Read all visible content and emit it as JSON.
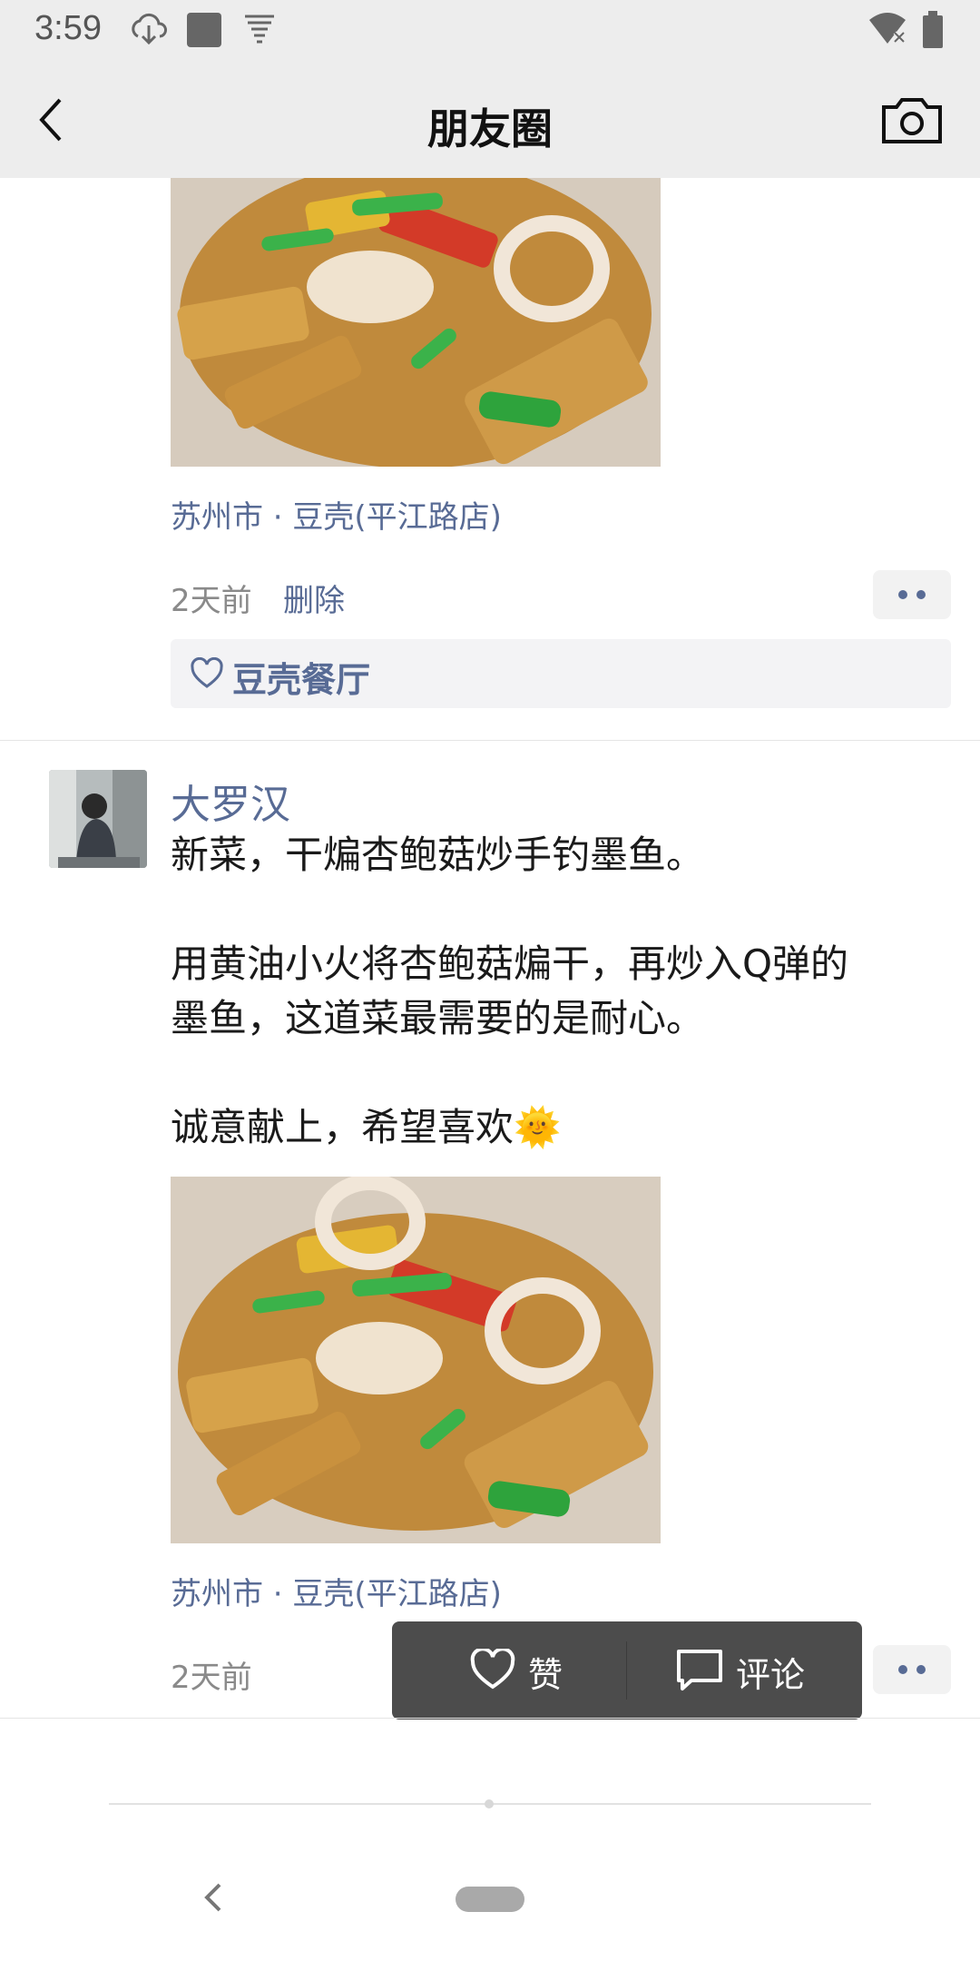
{
  "status_bar": {
    "time": "3:59"
  },
  "header": {
    "title": "朋友圈"
  },
  "post_top": {
    "location": "苏州市 · 豆壳(平江路店)",
    "time_ago": "2天前",
    "delete_label": "删除",
    "likes": [
      "豆壳餐厅"
    ]
  },
  "post_main": {
    "author": "大罗汉",
    "text_line1": "新菜，干煸杏鲍菇炒手钓墨鱼。",
    "text_line2": "用黄油小火将杏鲍菇煸干，再炒入Q弹的",
    "text_line3": "墨鱼，这道菜最需要的是耐心。",
    "text_line4": "诚意献上，希望喜欢🌞",
    "location": "苏州市 · 豆壳(平江路店)",
    "time_ago": "2天前"
  },
  "action_popup": {
    "like_label": "赞",
    "comment_label": "评论"
  },
  "colors": {
    "link_blue": "#586b95",
    "header_bg": "#ededed",
    "popup_bg": "#4c4c4c"
  }
}
